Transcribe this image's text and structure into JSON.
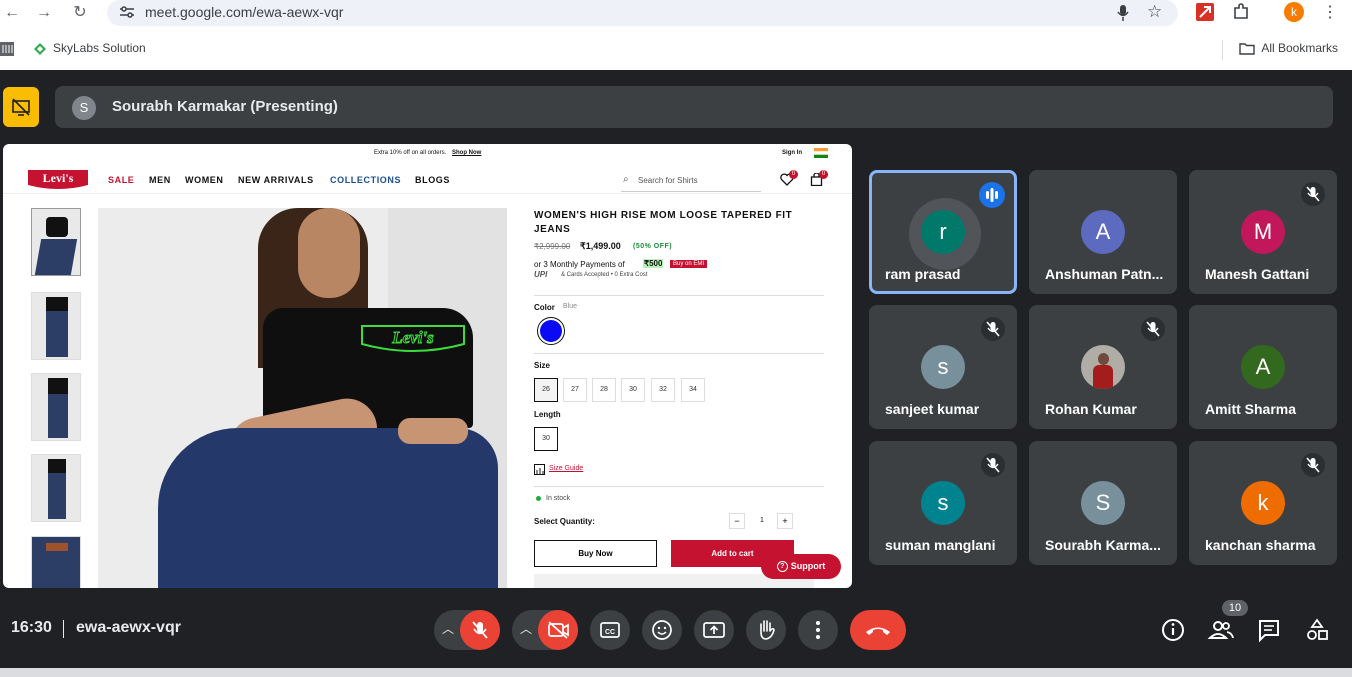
{
  "browser": {
    "url": "meet.google.com/ewa-aewx-vqr",
    "bookmark": "SkyLabs Solution",
    "all_bookmarks": "All Bookmarks",
    "profile_initial": "k"
  },
  "meet": {
    "presenter_initial": "S",
    "presenter_text": "Sourabh Karmakar (Presenting)",
    "time": "16:30",
    "meeting_code": "ewa-aewx-vqr",
    "participant_count": "10"
  },
  "participants": [
    {
      "initial": "r",
      "name": "ram prasad",
      "color": "#00796b",
      "state": "speaking"
    },
    {
      "initial": "A",
      "name": "Anshuman Patn...",
      "color": "#5c6bc0",
      "state": "normal"
    },
    {
      "initial": "M",
      "name": "Manesh Gattani",
      "color": "#c2185b",
      "state": "muted"
    },
    {
      "initial": "s",
      "name": "sanjeet kumar",
      "color": "#78909c",
      "state": "muted"
    },
    {
      "initial": "",
      "name": "Rohan Kumar",
      "color": "#9e9e9e",
      "state": "muted"
    },
    {
      "initial": "A",
      "name": "Amitt Sharma",
      "color": "#33691e",
      "state": "normal"
    },
    {
      "initial": "s",
      "name": "suman manglani",
      "color": "#00838f",
      "state": "muted"
    },
    {
      "initial": "S",
      "name": "Sourabh Karma...",
      "color": "#78909c",
      "state": "normal"
    },
    {
      "initial": "k",
      "name": "kanchan sharma",
      "color": "#ef6c00",
      "state": "muted"
    }
  ],
  "shared": {
    "promo": "Extra 10% off on all orders.",
    "shop_now": "Shop Now",
    "sign_in": "Sign In",
    "logo": "Levi's",
    "menu": [
      "SALE",
      "MEN",
      "WOMEN",
      "NEW ARRIVALS",
      "COLLECTIONS",
      "BLOGS"
    ],
    "search_placeholder": "Search for Shirts",
    "product_title": "WOMEN'S HIGH RISE MOM LOOSE TAPERED FIT JEANS",
    "mrp": "₹2,999.00",
    "price": "₹1,499.00",
    "discount": "(50% OFF)",
    "emi_prefix": "or 3 Monthly Payments of",
    "emi_amount": "₹500",
    "emi_badge": "Buy on EMI",
    "upi": "UPI",
    "cards": "& Cards Accepted • 0 Extra Cost",
    "color_label": "Color",
    "color_value": "Blue",
    "size_label": "Size",
    "sizes": [
      "26",
      "27",
      "28",
      "30",
      "32",
      "34"
    ],
    "length_label": "Length",
    "length_value": "30",
    "size_guide": "Size Guide",
    "stock": "In stock",
    "qty_label": "Select Quantity:",
    "qty": "1",
    "buy_now": "Buy Now",
    "add_to_cart": "Add to cart",
    "support": "Support",
    "wishlist_count": "0",
    "cart_count": "0"
  }
}
